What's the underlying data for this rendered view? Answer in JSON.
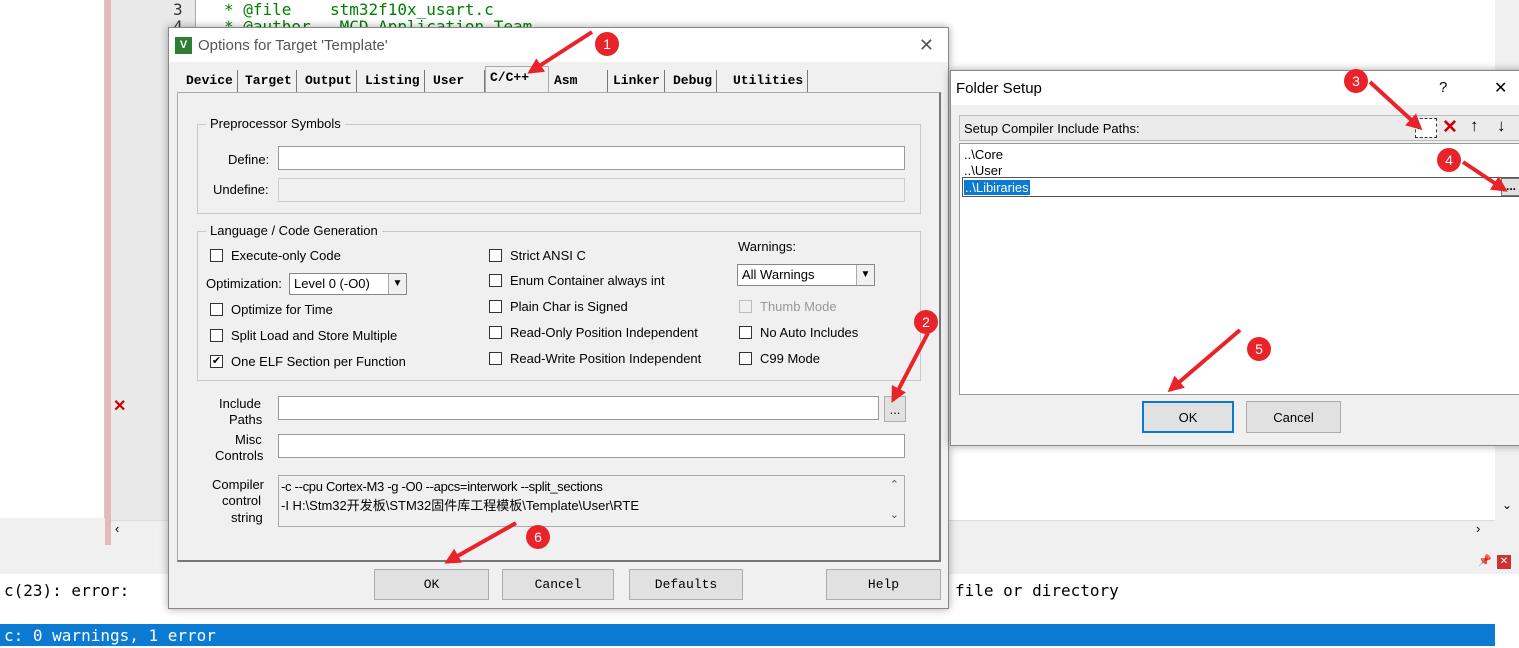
{
  "editor": {
    "line_number": "3",
    "line_text": "* @file    stm32f10x_usart.c",
    "line2_partial": "* @author   MCD Application Team",
    "line2_number": "4"
  },
  "build_output": {
    "line1_left": "c(23): error:",
    "line1_right": "file or directory",
    "line2": "c: 0 warnings, 1 error"
  },
  "options_dialog": {
    "title": "Options for Target 'Template'",
    "tabs": [
      {
        "label": "Device"
      },
      {
        "label": "Target"
      },
      {
        "label": "Output"
      },
      {
        "label": "Listing"
      },
      {
        "label": "User"
      },
      {
        "label": "C/C++",
        "active": true
      },
      {
        "label": "Asm"
      },
      {
        "label": "Linker"
      },
      {
        "label": "Debug"
      },
      {
        "label": "Utilities"
      }
    ],
    "preprocessor": {
      "legend": "Preprocessor Symbols",
      "define_label": "Define:",
      "define_value": "",
      "undefine_label": "Undefine:",
      "undefine_value": ""
    },
    "codegen": {
      "legend": "Language / Code Generation",
      "execute_only": {
        "label": "Execute-only Code",
        "checked": false
      },
      "optimization_label": "Optimization:",
      "optimization_value": "Level 0 (-O0)",
      "optimize_time": {
        "label": "Optimize for Time",
        "checked": false
      },
      "split_load": {
        "label": "Split Load and Store Multiple",
        "checked": false
      },
      "one_elf": {
        "label": "One ELF Section per Function",
        "checked": true
      },
      "strict_ansi": {
        "label": "Strict ANSI C",
        "checked": false
      },
      "enum_container": {
        "label": "Enum Container always int",
        "checked": false
      },
      "plain_char": {
        "label": "Plain Char is Signed",
        "checked": false
      },
      "ropi": {
        "label": "Read-Only Position Independent",
        "checked": false
      },
      "rwpi": {
        "label": "Read-Write Position Independent",
        "checked": false
      },
      "warnings_label": "Warnings:",
      "warnings_value": "All Warnings",
      "thumb_mode": {
        "label": "Thumb Mode",
        "checked": false,
        "disabled": true
      },
      "no_auto_includes": {
        "label": "No Auto Includes",
        "checked": false
      },
      "c99": {
        "label": "C99 Mode",
        "checked": false
      }
    },
    "include_paths": {
      "label_line1": "Include",
      "label_line2": "Paths",
      "value": "",
      "browse": "..."
    },
    "misc": {
      "label_line1": "Misc",
      "label_line2": "Controls",
      "value": ""
    },
    "compiler_string": {
      "label_line1": "Compiler",
      "label_line2": "control",
      "label_line3": "string",
      "line1": "-c --cpu Cortex-M3 -g -O0 --apcs=interwork --split_sections",
      "line2": "-I H:\\Stm32开发板\\STM32固件库工程模板\\Template\\User\\RTE"
    },
    "buttons": {
      "ok": "OK",
      "cancel": "Cancel",
      "defaults": "Defaults",
      "help": "Help"
    }
  },
  "folder_dialog": {
    "title": "Folder Setup",
    "help": "?",
    "close": "✕",
    "header": "Setup Compiler Include Paths:",
    "paths": [
      "..\\Core",
      "..\\User",
      "..\\Libiraries"
    ],
    "selected_index": 2,
    "browse": "...",
    "buttons": {
      "ok": "OK",
      "cancel": "Cancel"
    }
  },
  "annotations": [
    "1",
    "2",
    "3",
    "4",
    "5",
    "6"
  ],
  "colors": {
    "annotation": "#e8242a",
    "selection": "#0a7ad2",
    "code_green": "#008000"
  }
}
